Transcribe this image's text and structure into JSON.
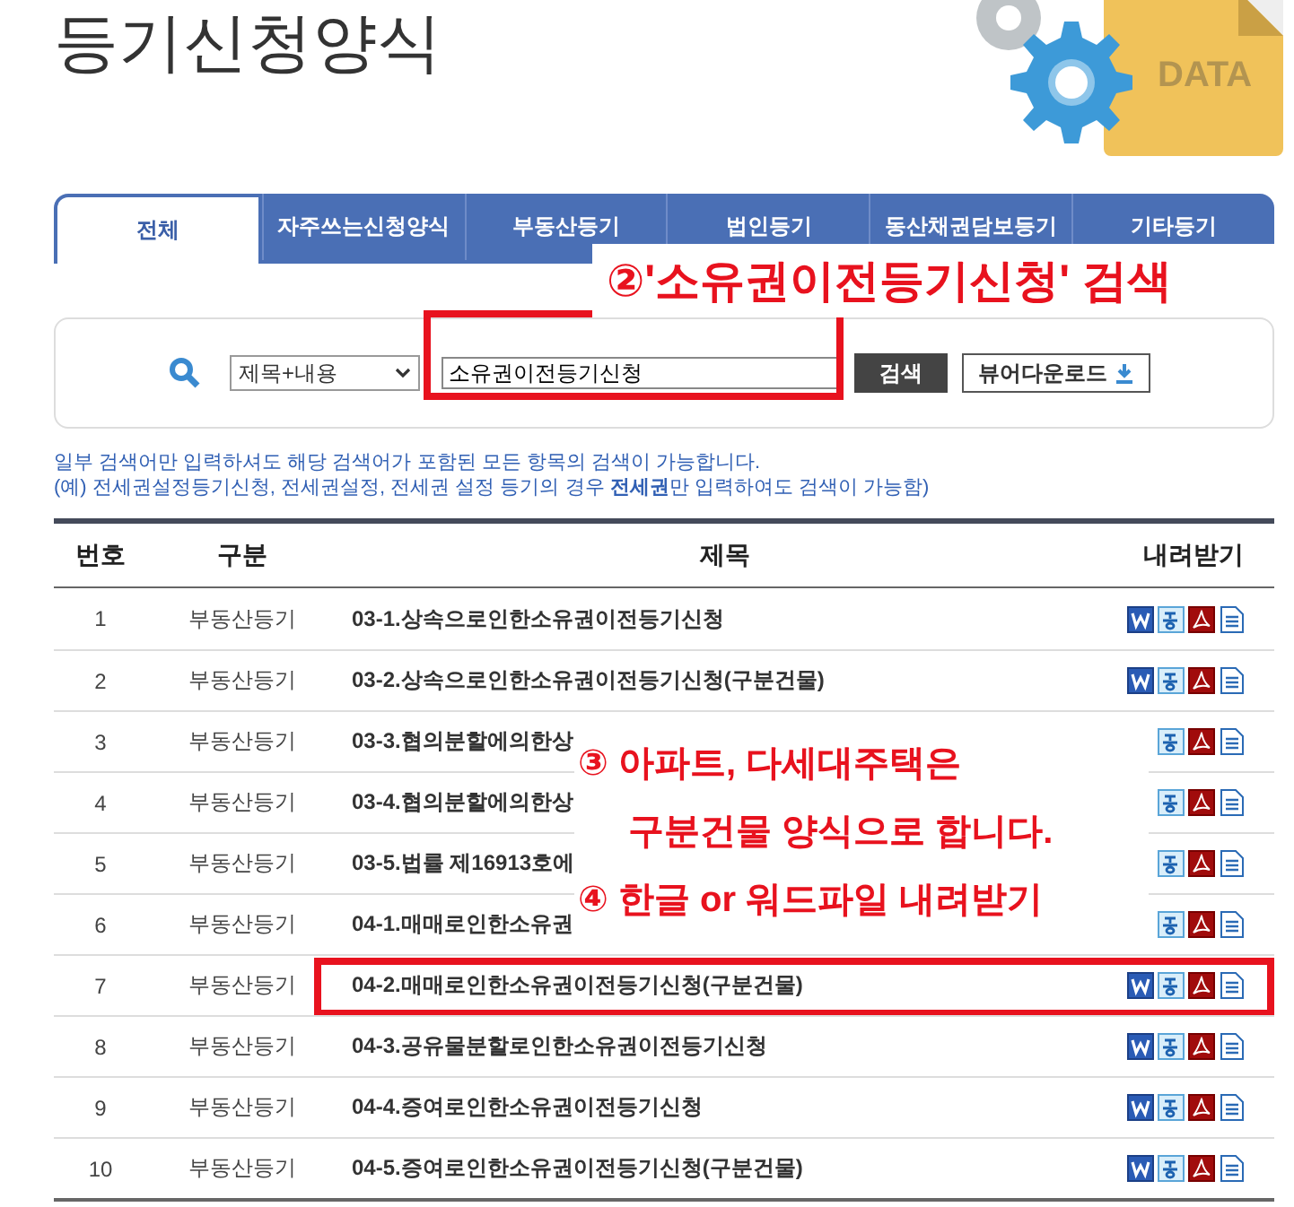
{
  "page_title": "등기신청양식",
  "logo_text": "DATA",
  "tabs": [
    {
      "label": "전체",
      "selected": true
    },
    {
      "label": "자주쓰는신청양식",
      "selected": false
    },
    {
      "label": "부동산등기",
      "selected": false
    },
    {
      "label": "법인등기",
      "selected": false
    },
    {
      "label": "동산채권담보등기",
      "selected": false
    },
    {
      "label": "기타등기",
      "selected": false
    }
  ],
  "search": {
    "scope": "제목+내용",
    "value": "소유권이전등기신청",
    "highlighted": true,
    "button": "검색",
    "viewer_button": "뷰어다운로드"
  },
  "notes": [
    "일부 검색어만 입력하셔도 해당 검색어가 포함된 모든 항목의 검색이 가능합니다.",
    "(예) 전세권설정등기신청, 전세권설정, 전세권 설정 등기의 경우 **전세권**만 입력하여도 검색이 가능함)"
  ],
  "table": {
    "columns": [
      "번호",
      "구분",
      "제목",
      "내려받기"
    ],
    "rows": [
      {
        "no": "1",
        "category": "부동산등기",
        "title": "03-1.상속으로인한소유권이전등기신청",
        "files": [
          {
            "kind": "word"
          },
          {
            "kind": "hwp"
          },
          {
            "kind": "pdf"
          },
          {
            "kind": "doc"
          }
        ],
        "highlighted": false
      },
      {
        "no": "2",
        "category": "부동산등기",
        "title": "03-2.상속으로인한소유권이전등기신청(구분건물)",
        "files": [
          {
            "kind": "word"
          },
          {
            "kind": "hwp"
          },
          {
            "kind": "pdf"
          },
          {
            "kind": "doc"
          }
        ],
        "highlighted": false
      },
      {
        "no": "3",
        "category": "부동산등기",
        "title": "03-3.협의분할에의한상",
        "files": [
          {
            "kind": "hwp"
          },
          {
            "kind": "pdf"
          },
          {
            "kind": "doc"
          }
        ],
        "highlighted": false
      },
      {
        "no": "4",
        "category": "부동산등기",
        "title": "03-4.협의분할에의한상",
        "files": [
          {
            "kind": "hwp"
          },
          {
            "kind": "pdf"
          },
          {
            "kind": "doc"
          }
        ],
        "highlighted": false
      },
      {
        "no": "5",
        "category": "부동산등기",
        "title": "03-5.법률 제16913호에",
        "files": [
          {
            "kind": "hwp"
          },
          {
            "kind": "pdf"
          },
          {
            "kind": "doc"
          }
        ],
        "highlighted": false
      },
      {
        "no": "6",
        "category": "부동산등기",
        "title": "04-1.매매로인한소유권",
        "files": [
          {
            "kind": "hwp"
          },
          {
            "kind": "pdf"
          },
          {
            "kind": "doc"
          }
        ],
        "highlighted": false
      },
      {
        "no": "7",
        "category": "부동산등기",
        "title": "04-2.매매로인한소유권이전등기신청(구분건물)",
        "files": [
          {
            "kind": "word"
          },
          {
            "kind": "hwp"
          },
          {
            "kind": "pdf"
          },
          {
            "kind": "doc"
          }
        ],
        "highlighted": true
      },
      {
        "no": "8",
        "category": "부동산등기",
        "title": "04-3.공유물분할로인한소유권이전등기신청",
        "files": [
          {
            "kind": "word"
          },
          {
            "kind": "hwp"
          },
          {
            "kind": "pdf"
          },
          {
            "kind": "doc"
          }
        ],
        "highlighted": false
      },
      {
        "no": "9",
        "category": "부동산등기",
        "title": "04-4.증여로인한소유권이전등기신청",
        "files": [
          {
            "kind": "word"
          },
          {
            "kind": "hwp"
          },
          {
            "kind": "pdf"
          },
          {
            "kind": "doc"
          }
        ],
        "highlighted": false
      },
      {
        "no": "10",
        "category": "부동산등기",
        "title": "04-5.증여로인한소유권이전등기신청(구분건물)",
        "files": [
          {
            "kind": "word"
          },
          {
            "kind": "hwp"
          },
          {
            "kind": "pdf"
          },
          {
            "kind": "doc"
          }
        ],
        "highlighted": false
      }
    ]
  },
  "annotations": [
    {
      "lines": [
        "②'소유권이전등기신청' 검색"
      ]
    },
    {
      "lines": [
        "③ 아파트, 다세대주택은",
        "구분건물 양식으로 합니다.",
        "④ 한글 or 워드파일 내려받기"
      ]
    }
  ]
}
